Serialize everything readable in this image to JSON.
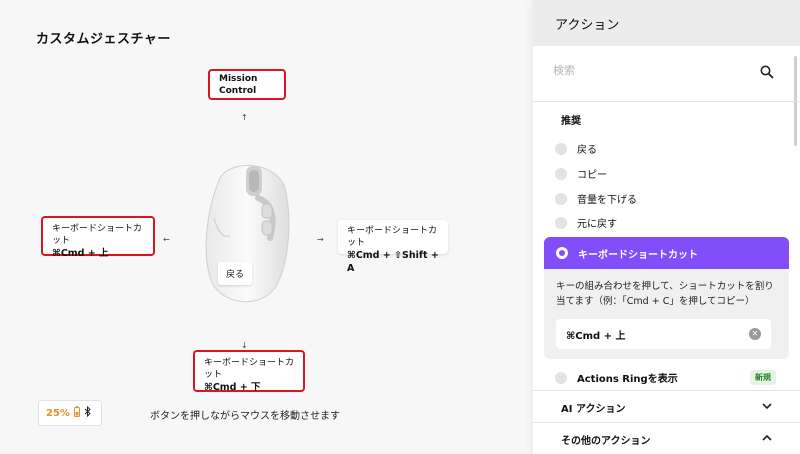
{
  "left": {
    "title": "カスタムジェスチャー",
    "up": {
      "label": "Mission Control"
    },
    "left": {
      "line1": "キーボードショートカット",
      "line2": "⌘Cmd + 上"
    },
    "right": {
      "line1": "キーボードショートカット",
      "line2": "⌘Cmd + ⇧Shift + A"
    },
    "down": {
      "line1": "キーボードショートカット",
      "line2": "⌘Cmd + 下"
    },
    "mouse_button_label": "戻る",
    "battery_percent": "25%",
    "hint": "ボタンを押しながらマウスを移動させます",
    "arrows": {
      "up": "↑",
      "left": "←",
      "right": "→",
      "down": "↓"
    }
  },
  "panel": {
    "title": "アクション",
    "search_placeholder": "検索",
    "recommended_label": "推奨",
    "items": [
      "戻る",
      "コピー",
      "音量を下げる",
      "元に戻す"
    ],
    "selected": {
      "label": "キーボードショートカット",
      "description": "キーの組み合わせを押して、ショートカットを割り当てます（例：「Cmd + C」を押してコピー）",
      "shortcut": "⌘Cmd + 上"
    },
    "actions_ring": {
      "label": "Actions Ringを表示",
      "badge": "新規"
    },
    "ai_actions": "AI アクション",
    "other_actions": "その他のアクション"
  },
  "colors": {
    "accent": "#814efa",
    "highlight_border": "#d9151f",
    "battery": "#e8902c"
  }
}
